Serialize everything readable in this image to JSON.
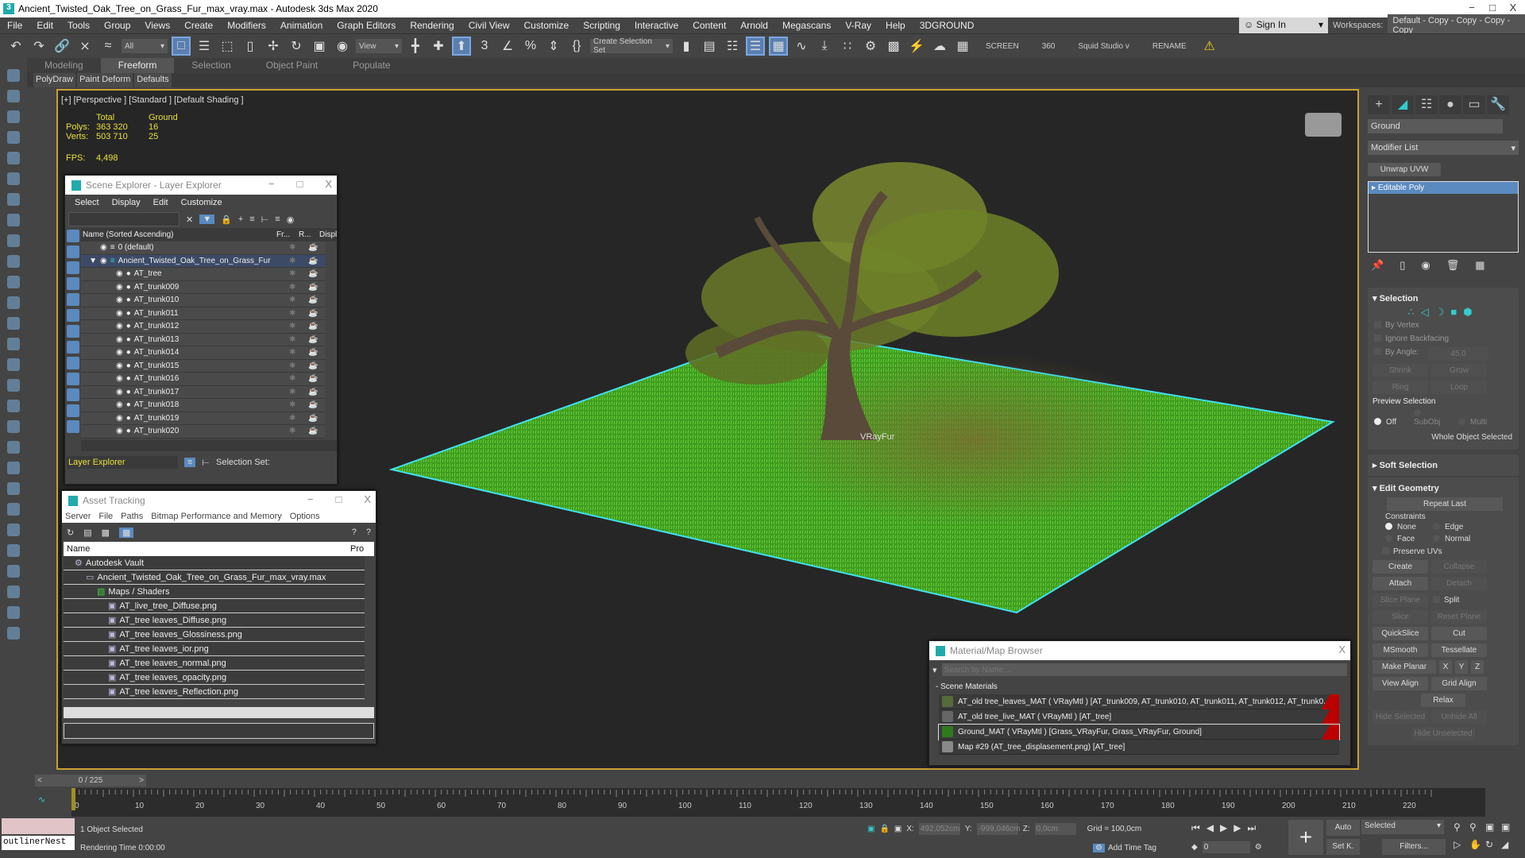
{
  "window": {
    "title": "Ancient_Twisted_Oak_Tree_on_Grass_Fur_max_vray.max - Autodesk 3ds Max 2020",
    "minimize": "−",
    "maximize": "□",
    "close": "X"
  },
  "menu": [
    "File",
    "Edit",
    "Tools",
    "Group",
    "Views",
    "Create",
    "Modifiers",
    "Animation",
    "Graph Editors",
    "Rendering",
    "Civil View",
    "Customize",
    "Scripting",
    "Interactive",
    "Content",
    "Arnold",
    "Megascans",
    "V-Ray",
    "Help",
    "3DGROUND"
  ],
  "account": {
    "sign_in": "Sign In",
    "workspaces_label": "Workspaces:",
    "workspace": "Default - Copy - Copy - Copy - Copy"
  },
  "toolbar": {
    "filter": "All",
    "ref_coord": "View",
    "selection_set": "Create Selection Set",
    "screen": "SCREEN",
    "b360": "360",
    "squid": "Squid Studio v",
    "rename": "RENAME"
  },
  "ribbon": {
    "tabs": [
      "Modeling",
      "Freeform",
      "Selection",
      "Object Paint",
      "Populate"
    ],
    "active": "Freeform",
    "sub": [
      "PolyDraw",
      "Paint Deform",
      "Defaults"
    ]
  },
  "viewport": {
    "label": "[+] [Perspective ] [Standard ] [Default Shading ]",
    "stats": {
      "col_total": "Total",
      "col_ground": "Ground",
      "polys_label": "Polys:",
      "polys_total": "363 320",
      "polys_ground": "16",
      "verts_label": "Verts:",
      "verts_total": "503 710",
      "verts_ground": "25",
      "fps_label": "FPS:",
      "fps": "4,498"
    },
    "object_label": "VRayFur",
    "colors": {
      "selection": "#40e0f0",
      "grass": "#3aa01c",
      "border": "#c8a030"
    }
  },
  "scene_explorer": {
    "title": "Scene Explorer - Layer Explorer",
    "menu": [
      "Select",
      "Display",
      "Edit",
      "Customize"
    ],
    "columns": {
      "name": "Name (Sorted Ascending)",
      "fr": "Fr...",
      "r": "R...",
      "disp": "Displ"
    },
    "rows": [
      {
        "name": "0 (default)",
        "level": 0
      },
      {
        "name": "Ancient_Twisted_Oak_Tree_on_Grass_Fur",
        "level": 0,
        "selected": true
      },
      {
        "name": "AT_tree",
        "level": 1
      },
      {
        "name": "AT_trunk009",
        "level": 1
      },
      {
        "name": "AT_trunk010",
        "level": 1
      },
      {
        "name": "AT_trunk011",
        "level": 1
      },
      {
        "name": "AT_trunk012",
        "level": 1
      },
      {
        "name": "AT_trunk013",
        "level": 1
      },
      {
        "name": "AT_trunk014",
        "level": 1
      },
      {
        "name": "AT_trunk015",
        "level": 1
      },
      {
        "name": "AT_trunk016",
        "level": 1
      },
      {
        "name": "AT_trunk017",
        "level": 1
      },
      {
        "name": "AT_trunk018",
        "level": 1
      },
      {
        "name": "AT_trunk019",
        "level": 1
      },
      {
        "name": "AT_trunk020",
        "level": 1
      }
    ],
    "footer_mode": "Layer Explorer",
    "selection_set_label": "Selection Set:"
  },
  "asset_tracking": {
    "title": "Asset Tracking",
    "menu": [
      "Server",
      "File",
      "Paths",
      "Bitmap Performance and Memory",
      "Options"
    ],
    "columns": {
      "name": "Name",
      "pro": "Pro"
    },
    "rows": [
      {
        "name": "Autodesk Vault",
        "level": 0
      },
      {
        "name": "Ancient_Twisted_Oak_Tree_on_Grass_Fur_max_vray.max",
        "level": 1
      },
      {
        "name": "Maps / Shaders",
        "level": 2
      },
      {
        "name": "AT_live_tree_Diffuse.png",
        "level": 3
      },
      {
        "name": "AT_tree leaves_Diffuse.png",
        "level": 3
      },
      {
        "name": "AT_tree leaves_Glossiness.png",
        "level": 3
      },
      {
        "name": "AT_tree leaves_ior.png",
        "level": 3
      },
      {
        "name": "AT_tree leaves_normal.png",
        "level": 3
      },
      {
        "name": "AT_tree leaves_opacity.png",
        "level": 3
      },
      {
        "name": "AT_tree leaves_Reflection.png",
        "level": 3
      }
    ]
  },
  "material_browser": {
    "title": "Material/Map Browser",
    "search_placeholder": "Search by Name ...",
    "group": "- Scene Materials",
    "rows": [
      {
        "name": "AT_old tree_leaves_MAT  ( VRayMtl )  [AT_trunk009, AT_trunk010, AT_trunk011, AT_trunk012, AT_trunk0...",
        "swatch": "#556b3a",
        "flag": true
      },
      {
        "name": "AT_old tree_live_MAT  ( VRayMtl ) [AT_tree]",
        "swatch": "#666",
        "flag": true
      },
      {
        "name": "Ground_MAT  ( VRayMtl ) [Grass_VRayFur, Grass_VRayFur, Ground]",
        "swatch": "#2f7a1e",
        "flag": true,
        "selected": true
      },
      {
        "name": "Map #29 (AT_tree_displasement.png)  [AT_tree]",
        "swatch": "#888",
        "flag": false
      }
    ]
  },
  "command_panel": {
    "object_name": "Ground",
    "modifier_list": "Modifier List",
    "unwrap": "Unwrap UVW",
    "stack_item": "Editable Poly",
    "selection": {
      "title": "Selection",
      "by_vertex": "By Vertex",
      "ignore_backfacing": "Ignore Backfacing",
      "by_angle": "By Angle:",
      "angle": "45,0",
      "shrink": "Shrink",
      "grow": "Grow",
      "ring": "Ring",
      "loop": "Loop",
      "preview": "Preview Selection",
      "off": "Off",
      "subobj": "SubObj",
      "multi": "Multi",
      "status": "Whole Object Selected"
    },
    "soft_selection": "Soft Selection",
    "edit_geometry": {
      "title": "Edit Geometry",
      "repeat_last": "Repeat Last",
      "constraints": "Constraints",
      "none": "None",
      "edge": "Edge",
      "face": "Face",
      "normal": "Normal",
      "preserve_uvs": "Preserve UVs",
      "create": "Create",
      "collapse": "Collapse",
      "attach": "Attach",
      "detach": "Detach",
      "slice_plane": "Slice Plane",
      "split": "Split",
      "slice": "Slice",
      "reset_plane": "Reset Plane",
      "quickslice": "QuickSlice",
      "cut": "Cut",
      "msmooth": "MSmooth",
      "tessellate": "Tessellate",
      "make_planar": "Make Planar",
      "x": "X",
      "y": "Y",
      "z": "Z",
      "view_align": "View Align",
      "grid_align": "Grid Align",
      "relax": "Relax",
      "hide_selected": "Hide Selected",
      "unhide_all": "Unhide All",
      "hide_unselected": "Hide Unselected"
    }
  },
  "timeline": {
    "frame": "0 / 225",
    "current": 0,
    "max": 225,
    "ticks": [
      0,
      10,
      20,
      30,
      40,
      50,
      60,
      70,
      80,
      90,
      100,
      110,
      120,
      130,
      140,
      150,
      160,
      170,
      180,
      190,
      200,
      210,
      220
    ]
  },
  "status": {
    "script": "outlinerNest",
    "selected": "1 Object Selected",
    "render_time": "Rendering Time  0:00:00",
    "x_label": "X:",
    "x": "492,052cm",
    "y_label": "Y:",
    "y": "-999,046cm",
    "z_label": "Z:",
    "z": "0,0cm",
    "grid": "Grid = 100,0cm",
    "add_time_tag": "Add Time Tag",
    "frame_field": "0",
    "auto": "Auto",
    "set_key": "Set K.",
    "key_filter": "Selected",
    "filters": "Filters..."
  }
}
